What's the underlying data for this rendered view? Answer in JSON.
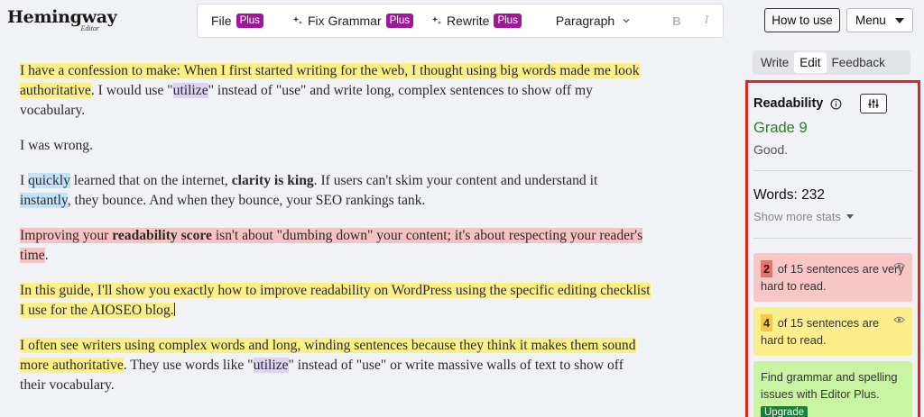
{
  "app": {
    "logo_main": "Hemingway",
    "logo_sub": "Editor"
  },
  "toolbar": {
    "file": "File",
    "fix_grammar": "Fix Grammar",
    "rewrite": "Rewrite",
    "plus": "Plus",
    "paragraph": "Paragraph",
    "bold": "B",
    "italic": "I"
  },
  "header": {
    "how_to_use": "How to use",
    "menu": "Menu"
  },
  "mode_tabs": {
    "write": "Write",
    "edit": "Edit",
    "feedback": "Feedback",
    "active": "Edit"
  },
  "editor": {
    "p1": {
      "a": "I have a confession to make: When I first started writing for the web, I thought using big words made me look authoritative",
      "b": ". I would use \"",
      "c": "utilize",
      "d": "\" instead of \"use\" and write long, complex sentences to show off my vocabulary."
    },
    "p2": "I was wrong.",
    "p3": {
      "a": "I ",
      "b": "quickly",
      "c": " learned that on the internet, ",
      "d": "clarity is king",
      "e": ". If users can't skim your content and understand it ",
      "f": "instantly",
      "g": ", they bounce. And when they bounce, your SEO rankings tank."
    },
    "p4": {
      "a": "Improving your ",
      "b": "readability score",
      "c": " isn't about \"dumbing down\" your content; it's about respecting your reader's time",
      "d": "."
    },
    "p5": "In this guide, I'll show you exactly how to improve readability on WordPress using the specific editing checklist I use for the AIOSEO blog.",
    "p6": {
      "a": "I often see writers using complex words and long, winding sentences because they think it makes them sound more authoritative",
      "b": ". They use words like \"",
      "c": "utilize",
      "d": "\" instead of \"use\" or write massive walls of text to show off their vocabulary."
    }
  },
  "sidebar": {
    "readability_title": "Readability",
    "grade": "Grade 9",
    "grade_comment": "Good.",
    "words": "Words: 232",
    "show_more": "Show more stats",
    "very_hard": {
      "count": "2",
      "text": "of 15 sentences are very hard to read."
    },
    "hard": {
      "count": "4",
      "text": "of 15 sentences are hard to read."
    },
    "grammar_text": "Find grammar and spelling issues with Editor Plus.",
    "upgrade": "Upgrade"
  },
  "colors": {
    "very_hard_bg": "#f9c6c6",
    "hard_bg": "#fdee8c",
    "adverb_bg": "#c4e2f8",
    "complex_word_bg": "#ddd3f4",
    "plus_badge": "#a2169e",
    "grade_green": "#2d7a2d",
    "sidebar_outline": "#e0271e"
  },
  "icons": [
    "sparkle-icon",
    "chevron-down-icon",
    "link-icon",
    "info-icon",
    "sliders-icon",
    "eye-icon",
    "caret-down-icon"
  ]
}
